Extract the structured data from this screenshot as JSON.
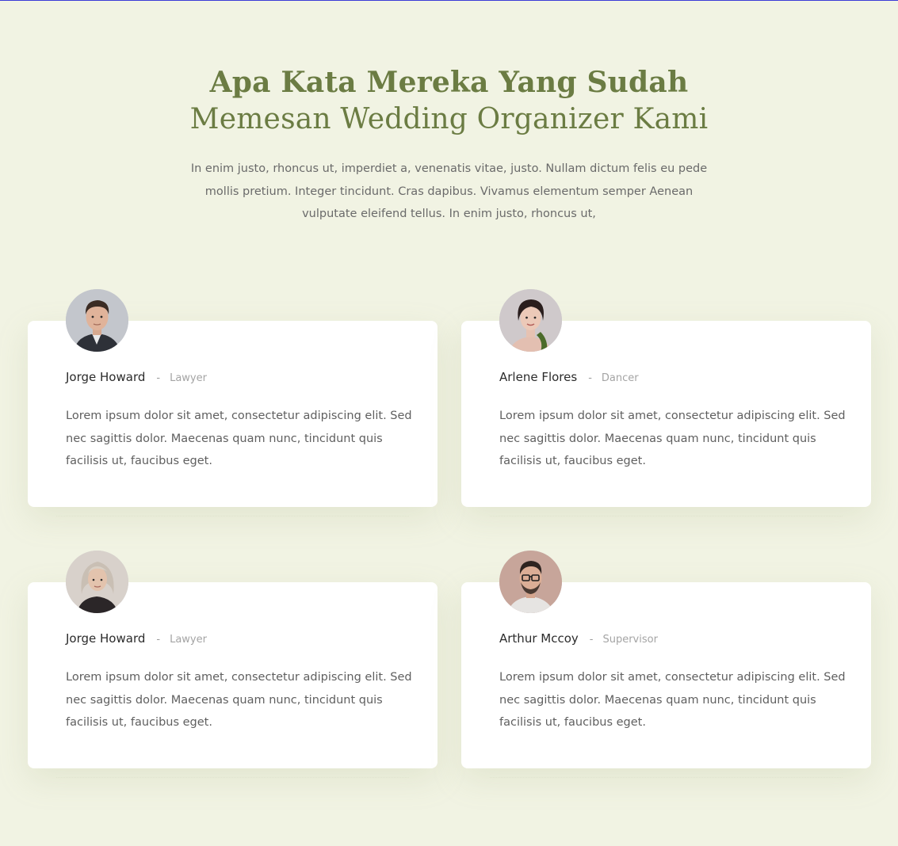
{
  "section": {
    "title_line1": "Apa Kata Mereka Yang Sudah",
    "title_line2": "Memesan Wedding Organizer Kami",
    "intro": "In enim justo, rhoncus ut, imperdiet a, venenatis vitae, justo. Nullam dictum felis eu pede mollis pretium. Integer tincidunt. Cras dapibus. Vivamus elementum semper Aenean vulputate eleifend tellus. In enim justo, rhoncus ut,"
  },
  "testimonials": [
    {
      "name": "Jorge Howard",
      "separator": "-",
      "role": "Lawyer",
      "text": "Lorem ipsum dolor sit amet, consectetur adipiscing elit. Sed nec sagittis dolor. Maecenas quam nunc, tincidunt quis facilisis ut, faucibus eget."
    },
    {
      "name": "Arlene Flores",
      "separator": "-",
      "role": "Dancer",
      "text": "Lorem ipsum dolor sit amet, consectetur adipiscing elit. Sed nec sagittis dolor. Maecenas quam nunc, tincidunt quis facilisis ut, faucibus eget."
    },
    {
      "name": "Jorge Howard",
      "separator": "-",
      "role": "Lawyer",
      "text": "Lorem ipsum dolor sit amet, consectetur adipiscing elit. Sed nec sagittis dolor. Maecenas quam nunc, tincidunt quis facilisis ut, faucibus eget."
    },
    {
      "name": "Arthur Mccoy",
      "separator": "-",
      "role": "Supervisor",
      "text": "Lorem ipsum dolor sit amet, consectetur adipiscing elit. Sed nec sagittis dolor. Maecenas quam nunc, tincidunt quis facilisis ut, faucibus eget."
    }
  ],
  "colors": {
    "background": "#f1f3e3",
    "heading": "#6b7c43",
    "card": "#ffffff",
    "body_text": "#5f5f5f",
    "muted": "#a4a4a4"
  }
}
